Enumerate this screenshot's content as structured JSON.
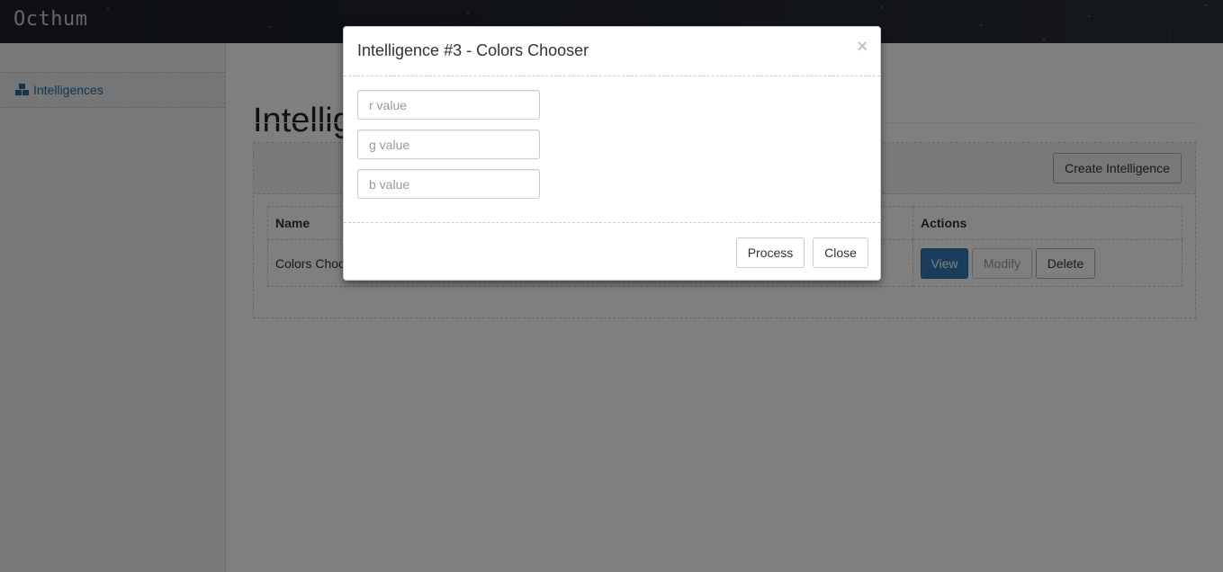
{
  "navbar": {
    "brand": "Octhum"
  },
  "sidebar": {
    "items": [
      {
        "label": "Intelligences",
        "icon": "cubes-icon"
      }
    ]
  },
  "main": {
    "title": "Intelligences",
    "create_button": "Create Intelligence",
    "table": {
      "columns": [
        "Name",
        "Actions"
      ],
      "rows": [
        {
          "name": "Colors Chooser",
          "actions": {
            "view": "View",
            "modify": "Modify",
            "delete": "Delete"
          }
        }
      ]
    }
  },
  "modal": {
    "title": "Intelligence #3 - Colors Chooser",
    "close_icon": "×",
    "inputs": [
      {
        "placeholder": "r value",
        "value": ""
      },
      {
        "placeholder": "g value",
        "value": ""
      },
      {
        "placeholder": "b value",
        "value": ""
      }
    ],
    "buttons": {
      "process": "Process",
      "close": "Close"
    }
  },
  "colors": {
    "primary": "#337ab7",
    "link": "#2a6b9c",
    "backdrop": "rgba(0,0,0,0.5)"
  }
}
